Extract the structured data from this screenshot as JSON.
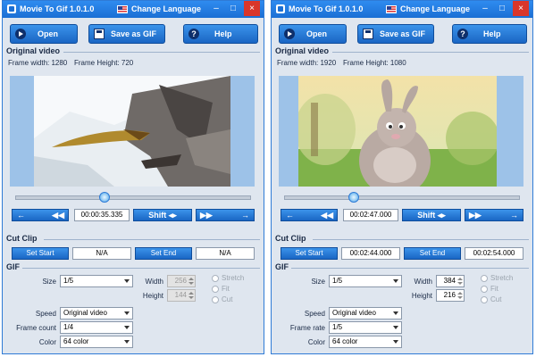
{
  "windows": [
    {
      "title": "Movie To Gif 1.0.1.0",
      "language_label": "Change Language",
      "toolbar": {
        "open": "Open",
        "save": "Save as GIF",
        "help": "Help"
      },
      "original_video": {
        "heading": "Original video",
        "frame_width": "Frame width: 1280",
        "frame_height": "Frame Height: 720"
      },
      "slider_position": 0.37,
      "time": "00:00:35.335",
      "nav": {
        "back": "←",
        "rewind": "◀◀",
        "shift": "Shift ◂▸",
        "forward": "▶▶",
        "next": "→"
      },
      "cut_clip": {
        "heading": "Cut Clip",
        "set_start": "Set Start",
        "start_value": "N/A",
        "set_end": "Set End",
        "end_value": "N/A"
      },
      "gif": {
        "heading": "GIF",
        "size_label": "Size",
        "size_value": "1/5",
        "width_label": "Width",
        "width_value": "256",
        "height_label": "Height",
        "height_value": "144",
        "stretch_label": "Stretch",
        "fit_label": "Fit",
        "cut_label": "Cut",
        "speed_label": "Speed",
        "speed_value": "Original video",
        "third_label": "Frame count",
        "third_value": "1/4",
        "color_label": "Color",
        "color_value": "64 color"
      }
    },
    {
      "title": "Movie To Gif 1.0.1.0",
      "language_label": "Change Language",
      "toolbar": {
        "open": "Open",
        "save": "Save as GIF",
        "help": "Help"
      },
      "original_video": {
        "heading": "Original video",
        "frame_width": "Frame width: 1920",
        "frame_height": "Frame Height: 1080"
      },
      "slider_position": 0.28,
      "time": "00:02:47.000",
      "nav": {
        "back": "←",
        "rewind": "◀◀",
        "shift": "Shift ◂▸",
        "forward": "▶▶",
        "next": "→"
      },
      "cut_clip": {
        "heading": "Cut Clip",
        "set_start": "Set Start",
        "start_value": "00:02:44.000",
        "set_end": "Set End",
        "end_value": "00:02:54.000"
      },
      "gif": {
        "heading": "GIF",
        "size_label": "Size",
        "size_value": "1/5",
        "width_label": "Width",
        "width_value": "384",
        "height_label": "Height",
        "height_value": "216",
        "stretch_label": "Stretch",
        "fit_label": "Fit",
        "cut_label": "Cut",
        "speed_label": "Speed",
        "speed_value": "Original video",
        "third_label": "Frame rate",
        "third_value": "1/5",
        "color_label": "Color",
        "color_value": "64 color"
      }
    }
  ]
}
